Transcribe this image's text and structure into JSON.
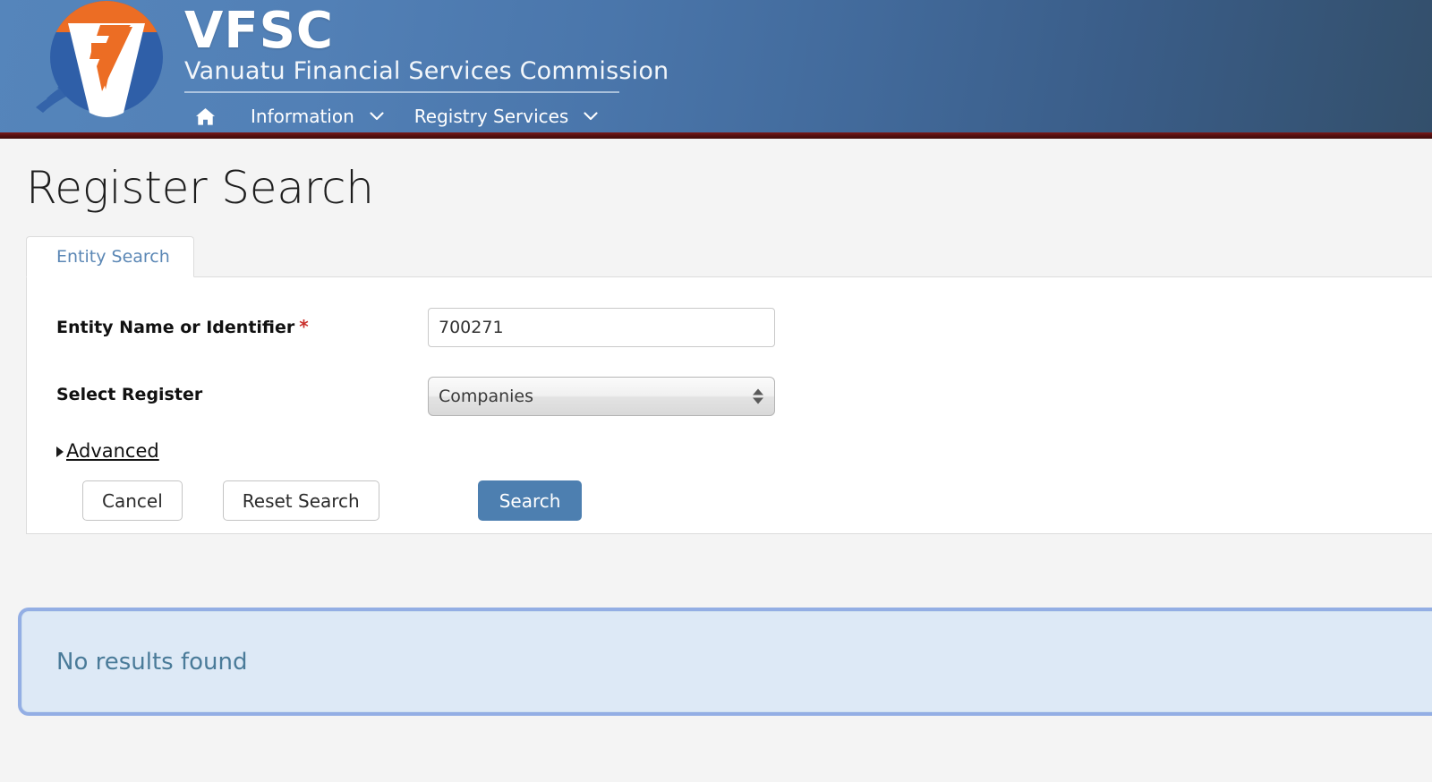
{
  "header": {
    "logo_icon": "vfsc-shield-logo",
    "brand_abbr": "VFSC",
    "brand_full": "Vanuatu Financial Services Commission",
    "nav": {
      "home_icon": "home-icon",
      "items": [
        {
          "label": "Information",
          "caret_icon": "chevron-down-icon"
        },
        {
          "label": "Registry Services",
          "caret_icon": "chevron-down-icon"
        }
      ]
    },
    "gradient_from": "#5585bb",
    "gradient_to": "#334f6b",
    "accent_bar_color": "#581010"
  },
  "page": {
    "title": "Register Search"
  },
  "tabs": [
    {
      "label": "Entity Search",
      "active": true
    }
  ],
  "form": {
    "fields": [
      {
        "label": "Entity Name or Identifier",
        "required": true,
        "required_marker": "*",
        "type": "text",
        "value": "700271",
        "placeholder": ""
      },
      {
        "label": "Select Register",
        "required": false,
        "type": "select",
        "value": "Companies",
        "options": [
          "Companies"
        ],
        "arrows_icon": "updown-arrows-icon"
      }
    ],
    "advanced": {
      "label": "Advanced",
      "disclosure_icon": "triangle-right-icon",
      "expanded": false
    },
    "buttons": {
      "cancel": "Cancel",
      "reset": "Reset Search",
      "search": "Search",
      "search_color": "#4d7fb0"
    }
  },
  "results": {
    "message": "No results found",
    "bg_color": "#dde9f6",
    "text_color": "#4a7b99",
    "focus_ring_color": "#93aee4"
  }
}
